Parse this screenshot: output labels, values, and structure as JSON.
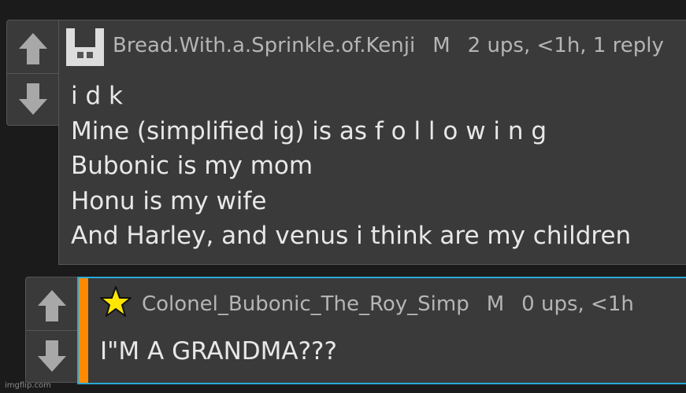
{
  "comments": [
    {
      "username": "Bread.With.a.Sprinkle.of.Kenji",
      "badge": "M",
      "meta": "2 ups, <1h, 1 reply",
      "avatar": "pixel-avatar-icon",
      "lines": [
        "i d k",
        "Mine (simplified ig) is as f o l l o w i n g",
        "Bubonic is my mom",
        "Honu is my wife",
        "And Harley, and venus i think are my children"
      ]
    },
    {
      "username": "Colonel_Bubonic_The_Roy_Simp",
      "badge": "M",
      "meta": "0 ups, <1h",
      "avatar": "star-icon",
      "lines": [
        "I\"M A GRANDMA???"
      ]
    }
  ],
  "watermark": "imgflip.com",
  "colors": {
    "background": "#1b1b1b",
    "panel": "#3a3a3a",
    "new_reply_border": "#2aa9d8",
    "new_reply_bar": "#ff8a00",
    "star": "#ffe600"
  }
}
